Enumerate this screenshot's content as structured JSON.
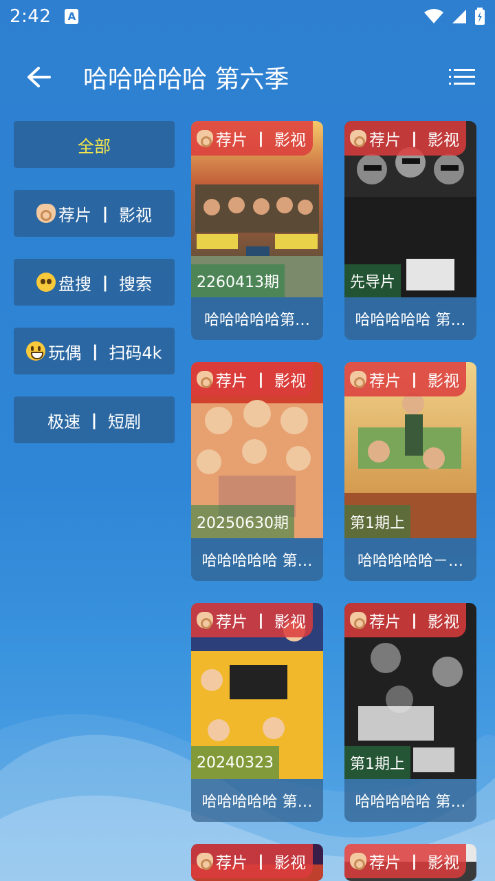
{
  "status": {
    "time": "2:42",
    "app_icon": "A"
  },
  "header": {
    "title": "哈哈哈哈哈 第六季"
  },
  "sidebar": {
    "items": [
      {
        "label": "全部",
        "active": true
      },
      {
        "left": "荐片",
        "right": "影视",
        "emoji": "ok-hand"
      },
      {
        "left": "盘搜",
        "right": "搜索",
        "emoji": "pleading-face"
      },
      {
        "left": "玩偶",
        "right": "扫码4k",
        "emoji": "smiley"
      },
      {
        "left": "极速",
        "right": "短剧"
      }
    ],
    "separator": "丨"
  },
  "cards": [
    {
      "tag_left": "荐片",
      "tag_right": "影视",
      "episode": "2260413期",
      "title": "哈哈哈哈哈第…"
    },
    {
      "tag_left": "荐片",
      "tag_right": "影视",
      "episode": "先导片",
      "title": "哈哈哈哈哈 第…"
    },
    {
      "tag_left": "荐片",
      "tag_right": "影视",
      "episode": "20250630期",
      "title": "哈哈哈哈哈 第…"
    },
    {
      "tag_left": "荐片",
      "tag_right": "影视",
      "episode": "第1期上",
      "title": "哈哈哈哈哈－…"
    },
    {
      "tag_left": "荐片",
      "tag_right": "影视",
      "episode": "20240323",
      "title": "哈哈哈哈哈 第…"
    },
    {
      "tag_left": "荐片",
      "tag_right": "影视",
      "episode": "第1期上",
      "title": "哈哈哈哈哈 第…"
    },
    {
      "tag_left": "荐片",
      "tag_right": "影视"
    },
    {
      "tag_left": "荐片",
      "tag_right": "影视"
    }
  ],
  "colors": {
    "accent": "#f6e84a",
    "tag": "#dc3c3c",
    "background": "#2e7fd0"
  }
}
